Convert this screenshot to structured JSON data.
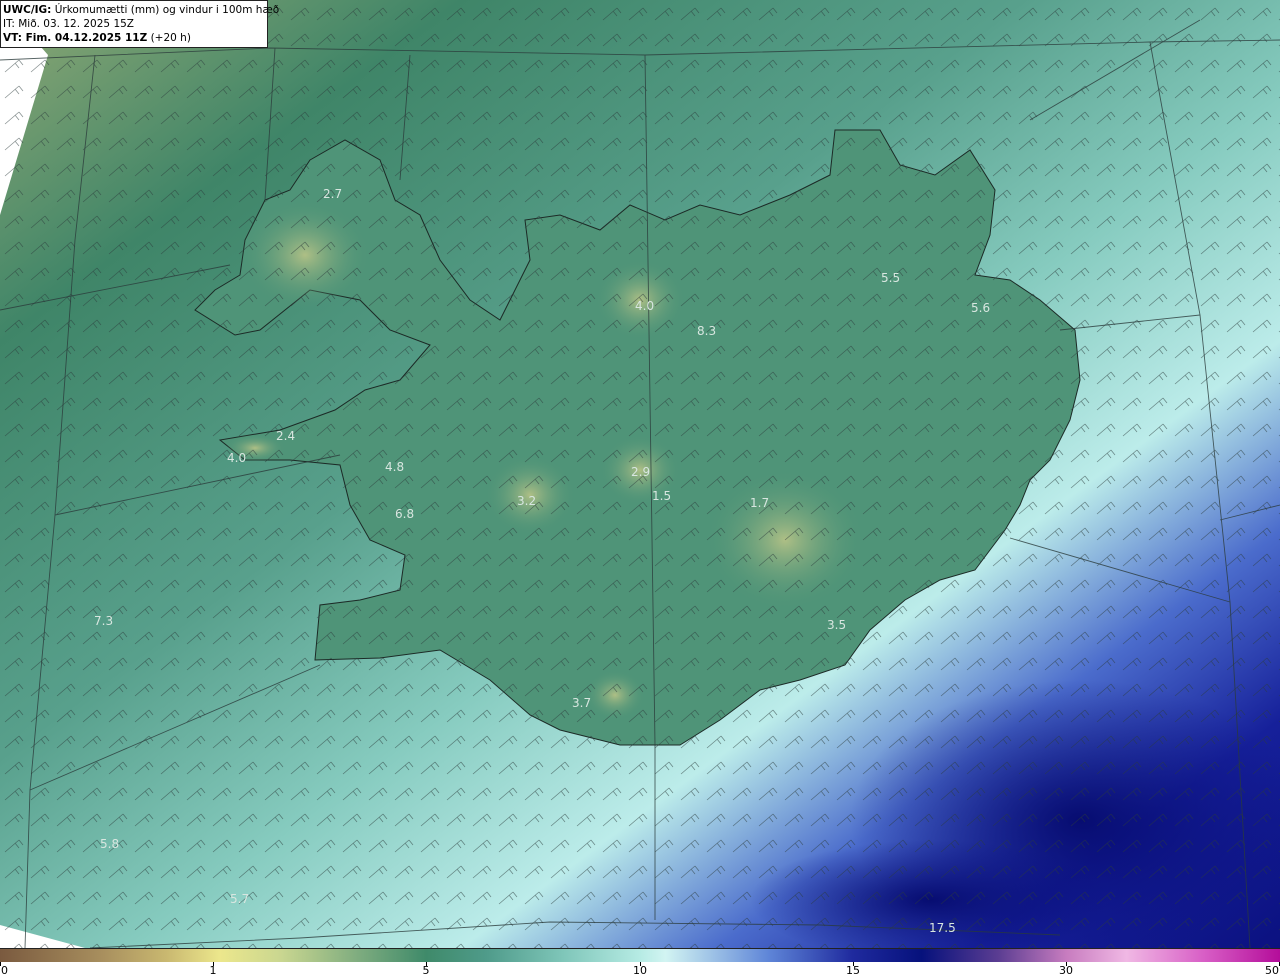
{
  "header": {
    "model_prefix": "UWC/IG:",
    "title": " Úrkomumætti (mm) og vindur i 100m hæð",
    "it_line": "IT: Mið. 03. 12. 2025 15Z",
    "vt_prefix": "VT: Fim. 04.12.2025 11Z",
    "vt_suffix": " (+20 h)"
  },
  "colorbar": {
    "ticks": [
      {
        "label": "0",
        "value": 0
      },
      {
        "label": "1",
        "value": 1
      },
      {
        "label": "5",
        "value": 5
      },
      {
        "label": "10",
        "value": 10
      },
      {
        "label": "15",
        "value": 15
      },
      {
        "label": "30",
        "value": 30
      },
      {
        "label": "50",
        "value": 50
      }
    ],
    "colors": {
      "low": "#7a5a3f",
      "tan": "#ece78c",
      "green": "#3f8a6a",
      "cyan": "#b6ebe4",
      "blue": "#1f2a9e",
      "navy": "#06117c",
      "pink": "#f0b8e4",
      "magenta": "#b40d9a"
    }
  },
  "values": [
    {
      "label": "2.7"
    },
    {
      "label": "4.0"
    },
    {
      "label": "8.3"
    },
    {
      "label": "5.5"
    },
    {
      "label": "5.6"
    },
    {
      "label": "2.4"
    },
    {
      "label": "4.0"
    },
    {
      "label": "4.8"
    },
    {
      "label": "3.2"
    },
    {
      "label": "2.9"
    },
    {
      "label": "1.5"
    },
    {
      "label": "1.7"
    },
    {
      "label": "6.8"
    },
    {
      "label": "7.3"
    },
    {
      "label": "3.5"
    },
    {
      "label": "3.7"
    },
    {
      "label": "5.8"
    },
    {
      "label": "5.7"
    },
    {
      "label": "17.5"
    }
  ]
}
